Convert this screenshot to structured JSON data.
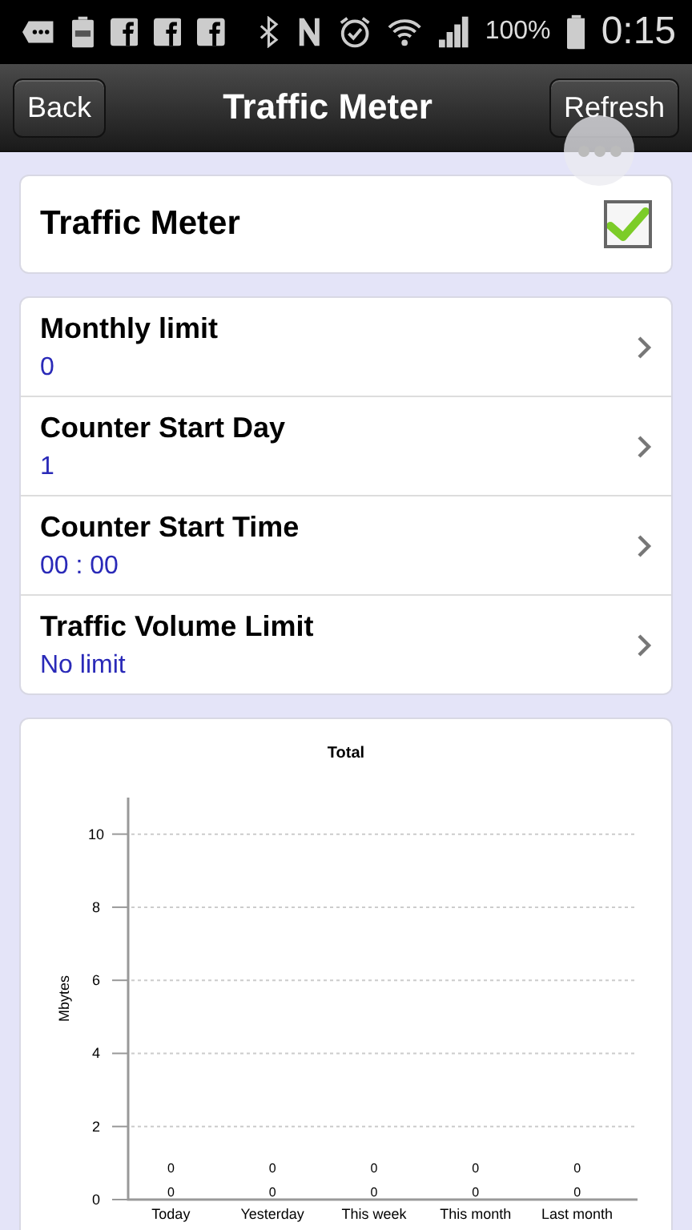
{
  "status_bar": {
    "battery": "100%",
    "time": "0:15"
  },
  "header": {
    "back": "Back",
    "title": "Traffic Meter",
    "refresh": "Refresh"
  },
  "toggle": {
    "label": "Traffic Meter",
    "checked": true
  },
  "settings": [
    {
      "label": "Monthly limit",
      "value": "0"
    },
    {
      "label": "Counter Start Day",
      "value": "1"
    },
    {
      "label": "Counter Start Time",
      "value": "00 : 00"
    },
    {
      "label": "Traffic Volume Limit",
      "value": "No limit"
    }
  ],
  "chart": {
    "chart_data": {
      "type": "bar",
      "title": "Total",
      "ylabel": "Mbytes",
      "categories": [
        "Today",
        "Yesterday",
        "This week",
        "This month",
        "Last month"
      ],
      "series": [
        {
          "values": [
            0,
            0,
            0,
            0,
            0
          ]
        },
        {
          "values": [
            0,
            0,
            0,
            0,
            0
          ]
        }
      ],
      "ylim": [
        0,
        11
      ],
      "grid": true,
      "yticks": [
        0,
        2,
        4,
        6,
        8,
        10
      ],
      "data_labels": true
    }
  }
}
